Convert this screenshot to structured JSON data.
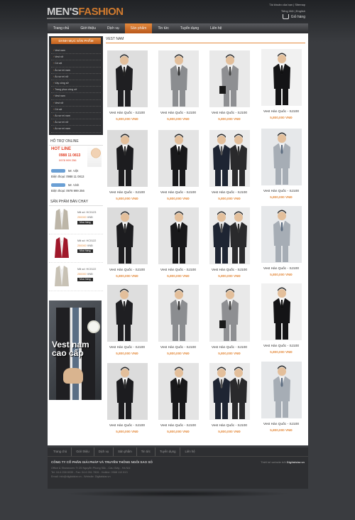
{
  "colors": {
    "accent": "#e48b3e",
    "background": "#3a3c40",
    "price": "#e48b3e",
    "hotline": "#e03d22"
  },
  "logo": {
    "part1": "MEN'S",
    "part2": "FASHION"
  },
  "top_links": {
    "login": "Tài khoản của bạn",
    "sitemap": "Sitemap",
    "lang_vi": "Tiếng Việt",
    "lang_en": "English"
  },
  "cart": {
    "icon": "cart-icon",
    "label": "Giỏ hàng"
  },
  "nav": [
    "Trang chủ",
    "Giới thiệu",
    "Dịch vụ",
    "Sản phẩm",
    "Tin tức",
    "Tuyển dụng",
    "Liên hệ"
  ],
  "nav_active_index": 3,
  "sidebar": {
    "category_title": "DANH MỤC SẢN PHẨM",
    "categories": [
      "Vest nam",
      "Vest nữ",
      "Cà vạt",
      "Áo sơ mi nam",
      "Áo sơ mi nữ",
      "Váy công sở",
      "Trang phục công sở",
      "Vest nam",
      "Vest nữ",
      "Cà vạt",
      "Áo sơ mi nam",
      "Áo sơ mi nữ",
      "Áo sơ mi nam"
    ],
    "support_title": "HỖ TRỢ ONLINE",
    "hotline_label": "HOT LINE",
    "hotline_phone1": "0988 11 0813",
    "hotline_phone2": "0978 999 256",
    "supporters": [
      {
        "name": "Mr. Việt",
        "phone_label": "Điện thoại",
        "phone": "0988 11 0813"
      },
      {
        "name": "Mr. Vinh",
        "phone_label": "Điện thoại",
        "phone": "0978 999 256"
      }
    ],
    "bestseller_title": "SẢN PHẨM BÁN CHẠY",
    "bestsellers": [
      {
        "code": "Mã số: HC0123",
        "price": "250000",
        "unit": "VNĐ",
        "buy": "Mua hàng"
      },
      {
        "code": "Mã số: HC0122",
        "price": "250000",
        "unit": "VNĐ",
        "buy": "Mua hàng"
      },
      {
        "code": "Mã số: HC0122",
        "price": "250000",
        "unit": "VNĐ",
        "buy": "Mua hàng"
      }
    ],
    "banner_text_line1": "Vest nam",
    "banner_text_line2": "cao cấp"
  },
  "main": {
    "title": "VEST NAM",
    "products": [
      {
        "name": "Vest Hàn Quốc - SJ100",
        "price": "5,800,000 VNĐ"
      },
      {
        "name": "Vest Hàn Quốc - SJ100",
        "price": "5,800,000 VNĐ"
      },
      {
        "name": "Vest Hàn Quốc - SJ100",
        "price": "5,800,000 VNĐ"
      },
      {
        "name": "Vest Hàn Quốc - SJ100",
        "price": "5,800,000 VNĐ"
      },
      {
        "name": "Vest Hàn Quốc - SJ100",
        "price": "5,800,000 VNĐ"
      },
      {
        "name": "Vest Hàn Quốc - SJ100",
        "price": "5,800,000 VNĐ"
      },
      {
        "name": "Vest Hàn Quốc - SJ100",
        "price": "5,800,000 VNĐ"
      },
      {
        "name": "Vest Hàn Quốc - SJ100",
        "price": "5,800,000 VNĐ"
      },
      {
        "name": "Vest Hàn Quốc - SJ100",
        "price": "5,800,000 VNĐ"
      },
      {
        "name": "Vest Hàn Quốc - SJ100",
        "price": "5,800,000 VNĐ"
      },
      {
        "name": "Vest Hàn Quốc - SJ100",
        "price": "5,800,000 VNĐ"
      },
      {
        "name": "Vest Hàn Quốc - SJ100",
        "price": "5,800,000 VNĐ"
      },
      {
        "name": "Vest Hàn Quốc - SJ100",
        "price": "5,800,000 VNĐ"
      },
      {
        "name": "Vest Hàn Quốc - SJ100",
        "price": "5,800,000 VNĐ"
      },
      {
        "name": "Vest Hàn Quốc - SJ100",
        "price": "5,800,000 VNĐ"
      },
      {
        "name": "Vest Hàn Quốc - SJ100",
        "price": "5,800,000 VNĐ"
      },
      {
        "name": "Vest Hàn Quốc - SJ100",
        "price": "5,800,000 VNĐ"
      },
      {
        "name": "Vest Hàn Quốc - SJ100",
        "price": "5,800,000 VNĐ"
      },
      {
        "name": "Vest Hàn Quốc - SJ100",
        "price": "5,800,000 VNĐ"
      },
      {
        "name": "Vest Hàn Quốc - SJ100",
        "price": "5,800,000 VNĐ"
      }
    ]
  },
  "footer": {
    "nav": [
      "Trang chủ",
      "Giới thiệu",
      "Dịch vụ",
      "Sản phẩm",
      "Tin tức",
      "Tuyển dụng",
      "Liên hệ"
    ],
    "company": "CÔNG TY CỔ PHẦN GIẢI PHÁP VÀ TRUYỀN THÔNG NGÔI SAO SỐ",
    "address": "Office & Showroom: Tr 25 Nguyễn Phong Sắc - Cầu Giấy - Hà Nội",
    "phone": "Tel: 04.6 258 8339 - Fax: 04.6 261 7826 - Hotline: 0988 110 813",
    "email": "Email: info@digitalstar.vn - Website: Digitalstar.vn",
    "designed_label": "Thiết kế website bởi",
    "designed_by": "Digitalstar.vn"
  }
}
